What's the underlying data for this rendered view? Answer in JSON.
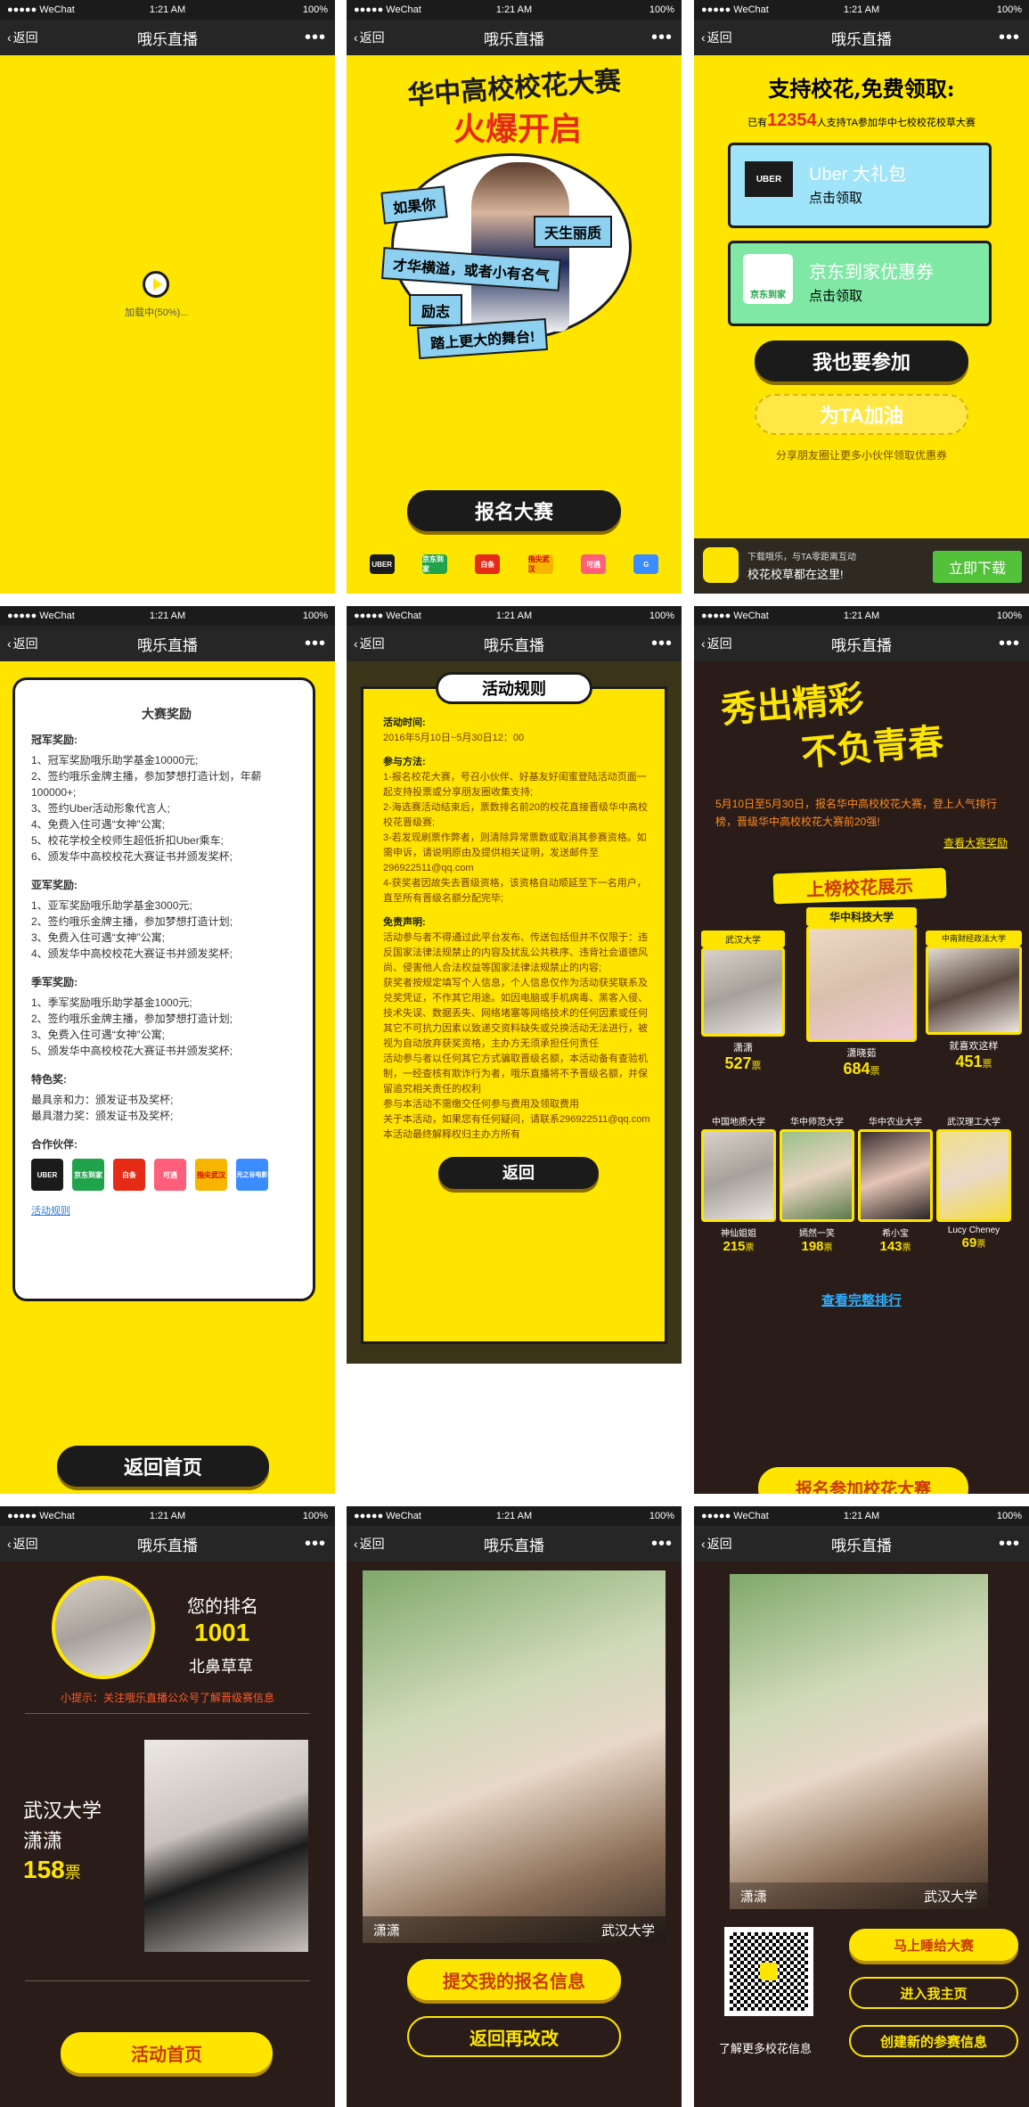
{
  "status_bar": {
    "carrier": "●●●●● WeChat",
    "time": "1:21 AM",
    "battery": "100%"
  },
  "nav": {
    "back": "返回",
    "title": "哦乐直播",
    "more": "•••"
  },
  "loading": {
    "text": "加载中(50%)..."
  },
  "contest_intro": {
    "title_line1": "华中高校校花大赛",
    "title_line2": "火爆开启",
    "ribbon1": "如果你",
    "ribbon2": "天生丽质",
    "ribbon3": "才华横溢，或者小有名气",
    "ribbon4": "励志",
    "ribbon5": "踏上更大的舞台!",
    "signup_button": "报名大赛",
    "sponsors": [
      "UBER",
      "京东到家",
      "白条",
      "指尖武汉",
      "可遇",
      "G"
    ]
  },
  "support": {
    "title": "支持校花,免费领取:",
    "count_prefix": "已有",
    "count": "12354",
    "count_suffix": "人支持TA参加华中七校校花校草大赛",
    "uber_card_title": "Uber 大礼包",
    "uber_card_sub": "点击领取",
    "uber_logo": "UBER",
    "jd_card_title": "京东到家优惠券",
    "jd_card_sub": "点击领取",
    "jd_logo": "京东到家",
    "join_button": "我也要参加",
    "cheer_button": "为TA加油",
    "share_tip": "分享朋友圈让更多小伙伴领取优惠券",
    "download_line1": "下载哦乐，与TA零距离互动",
    "download_line2": "校花校草都在这里!",
    "download_button": "立即下载"
  },
  "awards": {
    "title": "大赛奖励",
    "champion_heading": "冠军奖励:",
    "champion": [
      "1、冠军奖励哦乐助学基金10000元;",
      "2、签约哦乐金牌主播，参加梦想打造计划，年薪100000+;",
      "3、签约Uber活动形象代言人;",
      "4、免费入住可遇“女神”公寓;",
      "5、校花学校全校师生超低折扣Uber乘车;",
      "6、颁发华中高校校花大赛证书并颁发奖杯;"
    ],
    "runnerup_heading": "亚军奖励:",
    "runnerup": [
      "1、亚军奖励哦乐助学基金3000元;",
      "2、签约哦乐金牌主播，参加梦想打造计划;",
      "3、免费入住可遇“女神”公寓;",
      "4、颁发华中高校校花大赛证书并颁发奖杯;"
    ],
    "third_heading": "季军奖励:",
    "third": [
      "1、季军奖励哦乐助学基金1000元;",
      "2、签约哦乐金牌主播，参加梦想打造计划;",
      "3、免费入住可遇“女神”公寓;",
      "5、颁发华中高校校花大赛证书并颁发奖杯;"
    ],
    "special_heading": "特色奖:",
    "special": [
      "最具亲和力：颁发证书及奖杯;",
      "最具潜力奖：颁发证书及奖杯;"
    ],
    "partners_heading": "合作伙伴:",
    "partners": [
      "UBER",
      "京东到家",
      "白条",
      "可遇",
      "指尖武汉",
      "光之谷电影"
    ],
    "rules_link": "活动规则",
    "home_button": "返回首页"
  },
  "rules": {
    "title": "活动规则",
    "time_heading": "活动时间:",
    "time": "2016年5月10日~5月30日12：00",
    "method_heading": "参与方法:",
    "method": "1-报名校花大赛，号召小伙伴、好基友好闺蜜登陆活动页面一起支持投票或分享朋友圈收集支持;\n2-海选赛活动结束后，票数排名前20的校花直接晋级华中高校校花晋级赛;\n3-若发现刷票作弊者，则清除异常票数或取消其参赛资格。如需申诉，请说明原由及提供相关证明，发送邮件至296922511@qq.com\n4-获奖者因故失去晋级资格，该资格自动顺延至下一名用户，直至所有晋级名额分配完毕;",
    "disclaimer_heading": "免责声明:",
    "disclaimer": "活动参与者不得通过此平台发布、传送包括但并不仅限于：违反国家法律法规禁止的内容及扰乱公共秩序、违背社会道德风尚、侵害他人合法权益等国家法律法规禁止的内容;\n获奖者按规定填写个人信息，个人信息仅作为活动获奖联系及兑奖凭证，不作其它用途。如因电脑或手机病毒、黑客入侵、技术失误、数据丢失、网络堵塞等网络技术的任何因素或任何其它不可抗力因素以致递交资料缺失或兑换活动无法进行，被视为自动放弃获奖资格，主办方无须承担任何责任\n活动参与者以任何其它方式骗取晋级名额，本活动备有查验机制，一经查核有欺诈行为者，哦乐直播将不予晋级名额，并保留追究相关责任的权利\n参与本活动不需缴交任何参与费用及领取费用\n关于本活动，如果您有任何疑问，请联系296922511@qq.com\n本活动最终解释权归主办方所有",
    "back_button": "返回"
  },
  "ranking": {
    "headline_line1": "秀出精彩",
    "headline_line2": "不负青春",
    "desc": "5月10日至5月30日，报名华中高校校花大赛，登上人气排行榜，晋级华中高校校花大赛前20强!",
    "awards_link": "查看大赛奖励",
    "section_title": "上榜校花展示",
    "top3": [
      {
        "school": "武汉大学",
        "name": "潇潇",
        "votes": "527",
        "unit": "票"
      },
      {
        "school": "华中科技大学",
        "name": "潇晓茹",
        "votes": "684",
        "unit": "票"
      },
      {
        "school": "中南财经政法大学",
        "name": "就喜欢这样",
        "votes": "451",
        "unit": "票"
      }
    ],
    "others": [
      {
        "school": "中国地质大学",
        "name": "神仙姐姐",
        "votes": "215",
        "unit": "票"
      },
      {
        "school": "华中师范大学",
        "name": "嫣然一笑",
        "votes": "198",
        "unit": "票"
      },
      {
        "school": "华中农业大学",
        "name": "希小宝",
        "votes": "143",
        "unit": "票"
      },
      {
        "school": "武汉理工大学",
        "name": "Lucy Cheney",
        "votes": "69",
        "unit": "票"
      }
    ],
    "full_link": "查看完整排行",
    "signup_button": "报名参加校花大赛"
  },
  "my_rank": {
    "label": "您的排名",
    "rank": "1001",
    "name": "北鼻草草",
    "tip": "小提示：关注哦乐直播公众号了解晋级赛信息",
    "school": "武汉大学",
    "person": "潇潇",
    "votes": "158",
    "unit": "票",
    "home_button": "活动首页"
  },
  "submit": {
    "name": "潇潇",
    "school": "武汉大学",
    "submit_button": "提交我的报名信息",
    "edit_button": "返回再改改"
  },
  "share": {
    "name": "潇潇",
    "school": "武汉大学",
    "qr_tip": "了解更多校花信息",
    "btn_vote": "马上睡给大赛",
    "btn_home": "进入我主页",
    "btn_create": "创建新的参赛信息"
  },
  "colors": {
    "yellow": "#fde500",
    "dark": "#2a1c18",
    "orange_red": "#c93a00"
  }
}
